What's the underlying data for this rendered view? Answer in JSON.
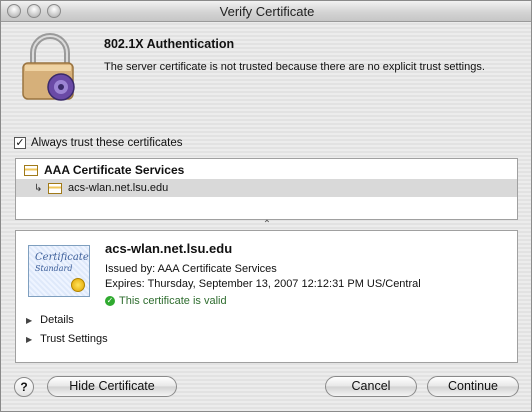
{
  "window": {
    "title": "Verify Certificate"
  },
  "header": {
    "heading": "802.1X Authentication",
    "message": "The server certificate is not trusted because there are no explicit trust settings."
  },
  "trust_checkbox": {
    "label": "Always trust these certificates",
    "checked": true
  },
  "cert_tree": {
    "items": [
      {
        "label": "AAA Certificate Services"
      },
      {
        "label": "acs-wlan.net.lsu.edu",
        "selected": true
      }
    ]
  },
  "details": {
    "cert_name": "acs-wlan.net.lsu.edu",
    "issued_by": "Issued by: AAA Certificate Services",
    "expires": "Expires: Thursday, September 13, 2007 12:12:31 PM US/Central",
    "status": "This certificate is valid",
    "thumb_script_1": "Certificate",
    "thumb_script_2": "Standard",
    "disclosures": [
      "Details",
      "Trust Settings"
    ]
  },
  "buttons": {
    "help": "?",
    "hide_certificate": "Hide Certificate",
    "cancel": "Cancel",
    "continue": "Continue"
  },
  "colors": {
    "valid_green": "#2faa2f",
    "selection_gray": "#d9d9d9"
  }
}
